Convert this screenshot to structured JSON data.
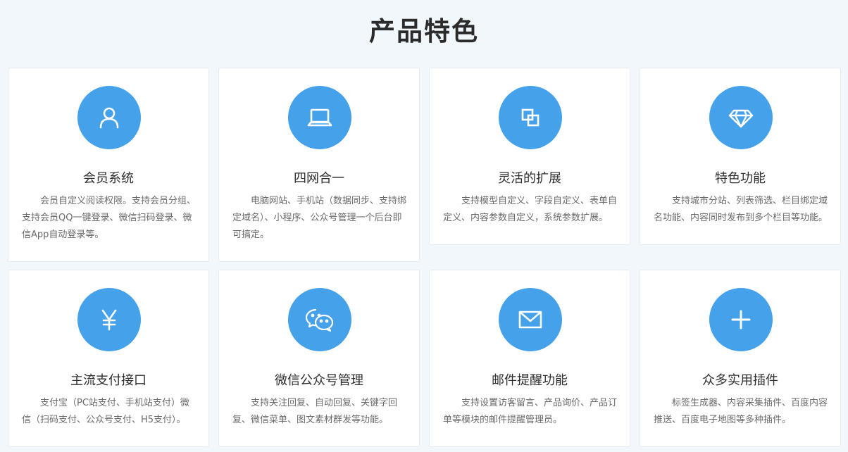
{
  "section": {
    "title": "产品特色"
  },
  "features": [
    {
      "title": "会员系统",
      "icon": "user-icon",
      "description": "会员自定义阅读权限。支持会员分组、支持会员QQ一键登录、微信扫码登录、微信App自动登录等。"
    },
    {
      "title": "四网合一",
      "icon": "laptop-icon",
      "description": "电脑网站、手机站（数据同步、支持绑定域名）、小程序、公众号管理一个后台即可搞定。"
    },
    {
      "title": "灵活的扩展",
      "icon": "extend-icon",
      "description": "支持模型自定义、字段自定义、表单自定义、内容参数自定义，系统参数扩展。"
    },
    {
      "title": "特色功能",
      "icon": "diamond-icon",
      "description": "支持城市分站、列表筛选、栏目绑定域名功能、内容同时发布到多个栏目等功能。"
    },
    {
      "title": "主流支付接口",
      "icon": "yen-icon",
      "description": "支付宝（PC站支付、手机站支付）微信（扫码支付、公众号支付、H5支付）。"
    },
    {
      "title": "微信公众号管理",
      "icon": "wechat-icon",
      "description": "支持关注回复、自动回复、关键字回复、微信菜单、图文素材群发等功能。"
    },
    {
      "title": "邮件提醒功能",
      "icon": "mail-icon",
      "description": "支持设置访客留言、产品询价、产品订单等模块的邮件提醒管理员。"
    },
    {
      "title": "众多实用插件",
      "icon": "plus-icon",
      "description": "标签生成器、内容采集插件、百度内容推送、百度电子地图等多种插件。"
    }
  ],
  "colors": {
    "accent": "#45a1ea",
    "background": "#f2f7fc"
  }
}
